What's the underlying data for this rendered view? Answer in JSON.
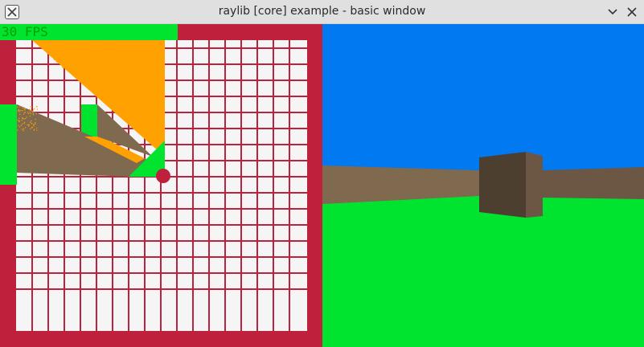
{
  "window": {
    "title": "raylib [core] example - basic window",
    "icons": {
      "app": "raylib-x-icon",
      "minimize": "chevron-down-icon",
      "close": "close-icon"
    }
  },
  "hud": {
    "fps_text": "30 FPS",
    "fps_color": "#00a000"
  },
  "colors": {
    "map_wall": "#be213b",
    "map_floor": "#f5f5f5",
    "map_block": "#00e430",
    "ray_fan": "#ffa100",
    "wall_face": "#7f6a4f",
    "player": "#be213b",
    "sky": "#0079f1",
    "ground": "#00e430",
    "box_front": "#4c3f2f",
    "box_side": "#6b5744"
  }
}
